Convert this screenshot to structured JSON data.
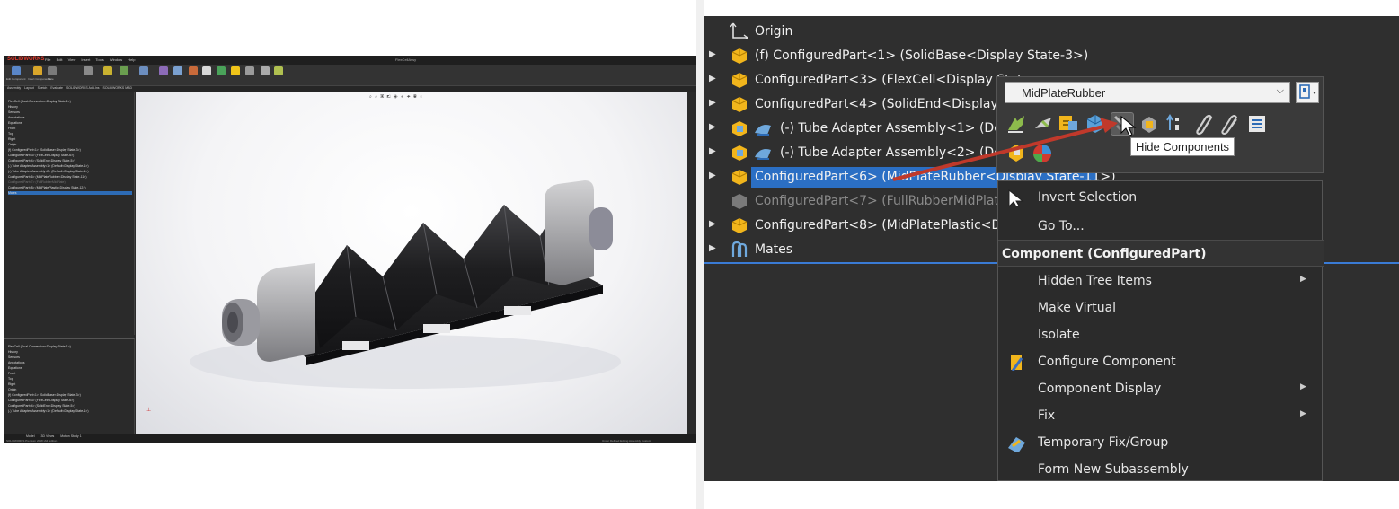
{
  "left_screenshot": {
    "app_name": "SOLIDWORKS",
    "menu": [
      "File",
      "Edit",
      "View",
      "Insert",
      "Tools",
      "Window",
      "Help"
    ],
    "document_title": "FlexCellAssy",
    "ribbon_labels": [
      "Edit Component",
      "Insert Components",
      "Mate",
      "Linear Component Pattern",
      "Smart Fasteners",
      "Move Component",
      "Show Hidden Components",
      "Assembly Features",
      "Reference Geometry",
      "New Motion Study",
      "Bill of Materials",
      "Exploded View",
      "Instant3D",
      "Update Speedpak",
      "Take Snapshot",
      "Large Assembly Mode"
    ],
    "tabs": [
      "Assembly",
      "Layout",
      "Sketch",
      "Evaluate",
      "SOLIDWORKS Add-Ins",
      "SOLIDWORKS MBD"
    ],
    "tree_items": [
      "FlexCell (Dual-Connection<Display State-1>)",
      "History",
      "Sensors",
      "Annotations",
      "Equations",
      "Front",
      "Top",
      "Right",
      "Origin",
      "(f) ConfiguredPart<1> (SolidBase<Display State-3>)",
      "ConfiguredPart<3> (FlexCell<Display State-6>)",
      "ConfiguredPart<4> (SolidEnd<Display State-5>)",
      "(-) Tube Adapter Assembly<1> (Default<Display State-1>)",
      "(-) Tube Adapter Assembly<2> (Default<Display State-1>)",
      "ConfiguredPart<6> (MidPlateRubber<Display State-11>)",
      "ConfiguredPart<7> (FullRubberMidPlate)",
      "ConfiguredPart<8> (MidPlatePlastic<Display State-12>)",
      "Mates"
    ],
    "status_tabs": [
      "Model",
      "3D Views",
      "Motion Study 1"
    ],
    "status_left": "SOLIDWORKS Premium 2018 x64 Edition",
    "status_right": "Under Defined   Editing Assembly   Custom"
  },
  "feature_tree": {
    "origin_label": "Origin",
    "rows": [
      {
        "label": "(f) ConfiguredPart<1> (SolidBase<Display State-3>)",
        "icon": "part-icon",
        "state": "normal"
      },
      {
        "label": "ConfiguredPart<3> (FlexCell<Display State-",
        "icon": "part-icon",
        "state": "normal"
      },
      {
        "label": "ConfiguredPart<4> (SolidEnd<Display St",
        "icon": "part-icon",
        "state": "normal"
      },
      {
        "label": "(-) Tube Adapter Assembly<1> (Def",
        "icon": "assembly-icon",
        "state": "normal"
      },
      {
        "label": "(-) Tube Adapter Assembly<2> (Def",
        "icon": "assembly-icon",
        "state": "normal"
      },
      {
        "label": "ConfiguredPart<6> (MidPlateRubber<Display State-11>)",
        "icon": "part-icon",
        "state": "selected"
      },
      {
        "label": "ConfiguredPart<7> (FullRubberMidPlate)",
        "icon": "part-icon",
        "state": "suppressed"
      },
      {
        "label": "ConfiguredPart<8> (MidPlatePlastic<Disp",
        "icon": "part-icon",
        "state": "normal"
      },
      {
        "label": "Mates",
        "icon": "mates-icon",
        "state": "normal"
      }
    ]
  },
  "context_toolbar": {
    "configuration_value": "MidPlateRubber",
    "tooltip": "Hide Components",
    "icons": [
      "open-part-icon",
      "edit-part-icon",
      "edit-sketch-icon",
      "view-icon",
      "hide-components-icon",
      "fix-icon",
      "list-icon",
      "mate-icon",
      "mate-ref-icon",
      "properties-icon",
      "appearance-icon"
    ]
  },
  "context_menu": {
    "items_top": [
      {
        "label": "Invert Selection",
        "icon": "cursor-icon"
      },
      {
        "label": "Go To...",
        "icon": null
      }
    ],
    "header": "Component (ConfiguredPart)",
    "items": [
      {
        "label": "Hidden Tree Items",
        "submenu": true,
        "icon": null
      },
      {
        "label": "Make Virtual",
        "submenu": false,
        "icon": null
      },
      {
        "label": "Isolate",
        "submenu": false,
        "icon": null
      },
      {
        "label": "Configure Component",
        "submenu": false,
        "icon": "configure-icon"
      },
      {
        "label": "Component Display",
        "submenu": true,
        "icon": null
      },
      {
        "label": "Fix",
        "submenu": true,
        "icon": null
      },
      {
        "label": "Temporary Fix/Group",
        "submenu": false,
        "icon": "temp-fix-icon"
      },
      {
        "label": "Form New Subassembly",
        "submenu": false,
        "icon": null
      }
    ]
  },
  "colors": {
    "selection": "#2b6fc4",
    "accent_red": "#c0392b",
    "part_yellow": "#f1b51c",
    "assembly_blue": "#6fa8dc"
  }
}
